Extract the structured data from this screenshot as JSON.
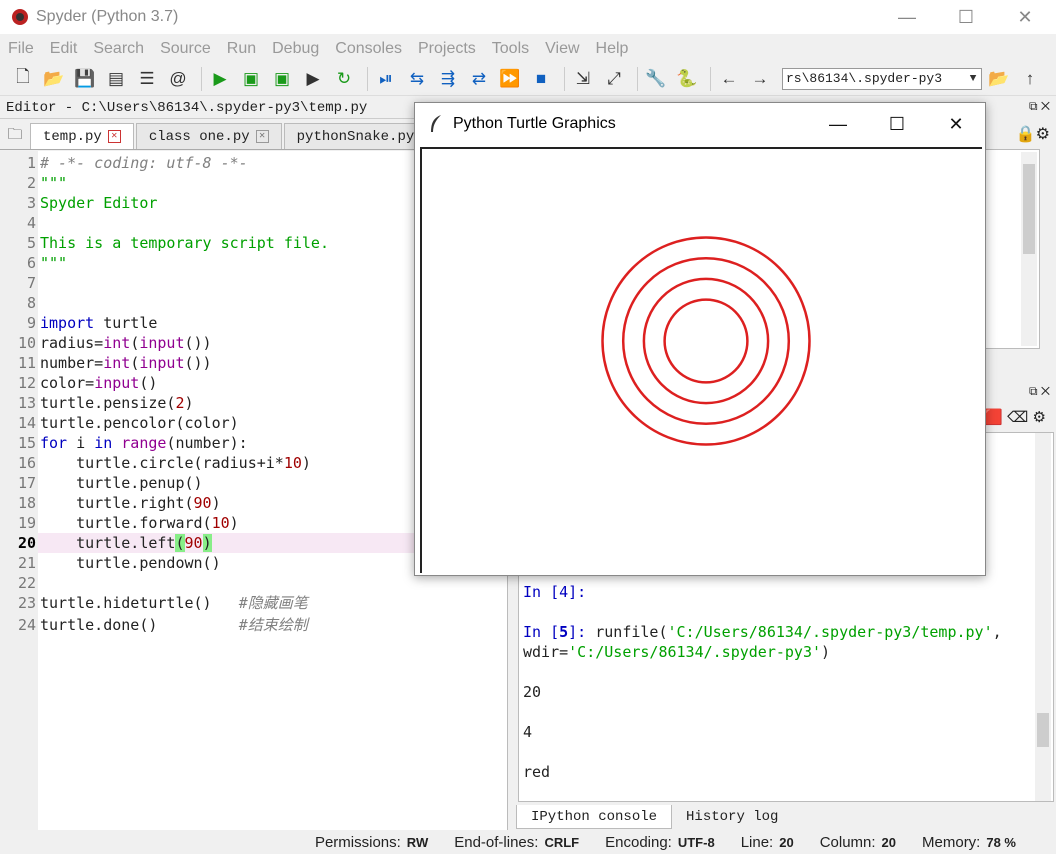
{
  "app": {
    "title": "Spyder (Python 3.7)",
    "minimize": "—",
    "maximize": "☐",
    "close": "✕"
  },
  "menu": [
    "File",
    "Edit",
    "Search",
    "Source",
    "Run",
    "Debug",
    "Consoles",
    "Projects",
    "Tools",
    "View",
    "Help"
  ],
  "toolbar": {
    "working_dir": "rs\\86134\\.spyder-py3"
  },
  "editor": {
    "title": "Editor - C:\\Users\\86134\\.spyder-py3\\temp.py",
    "tabs": [
      {
        "label": "temp.py",
        "active": true
      },
      {
        "label": "class one.py",
        "active": false
      },
      {
        "label": "pythonSnake.py",
        "active": false
      }
    ],
    "current_line": 20
  },
  "turtle_window": {
    "title": "Python Turtle Graphics",
    "circles": {
      "count": 4,
      "base_radius": 20,
      "step": 10,
      "color": "#dd2020"
    }
  },
  "console": {
    "prompt4": "In [4]:",
    "prompt5_in": "In [",
    "prompt5_num": "5",
    "prompt5_close": "]:",
    "run_cmd": " runfile(",
    "run_path": "'C:/Users/86134/.spyder-py3/temp.py'",
    "run_sep": ",",
    "wdir_label": "wdir=",
    "wdir_path": "'C:/Users/86134/.spyder-py3'",
    "wdir_close": ")",
    "out1": "20",
    "out2": "4",
    "out3": "red",
    "tabs": [
      "IPython console",
      "History log"
    ]
  },
  "status": {
    "permissions_label": "Permissions:",
    "permissions": "RW",
    "eol_label": "End-of-lines:",
    "eol": "CRLF",
    "encoding_label": "Encoding:",
    "encoding": "UTF-8",
    "line_label": "Line:",
    "line": "20",
    "column_label": "Column:",
    "column": "20",
    "memory_label": "Memory:",
    "memory": "78 %"
  },
  "colors": {
    "accent_green": "#1a9a1a",
    "accent_blue": "#1060c0",
    "circle_red": "#dd2020"
  }
}
